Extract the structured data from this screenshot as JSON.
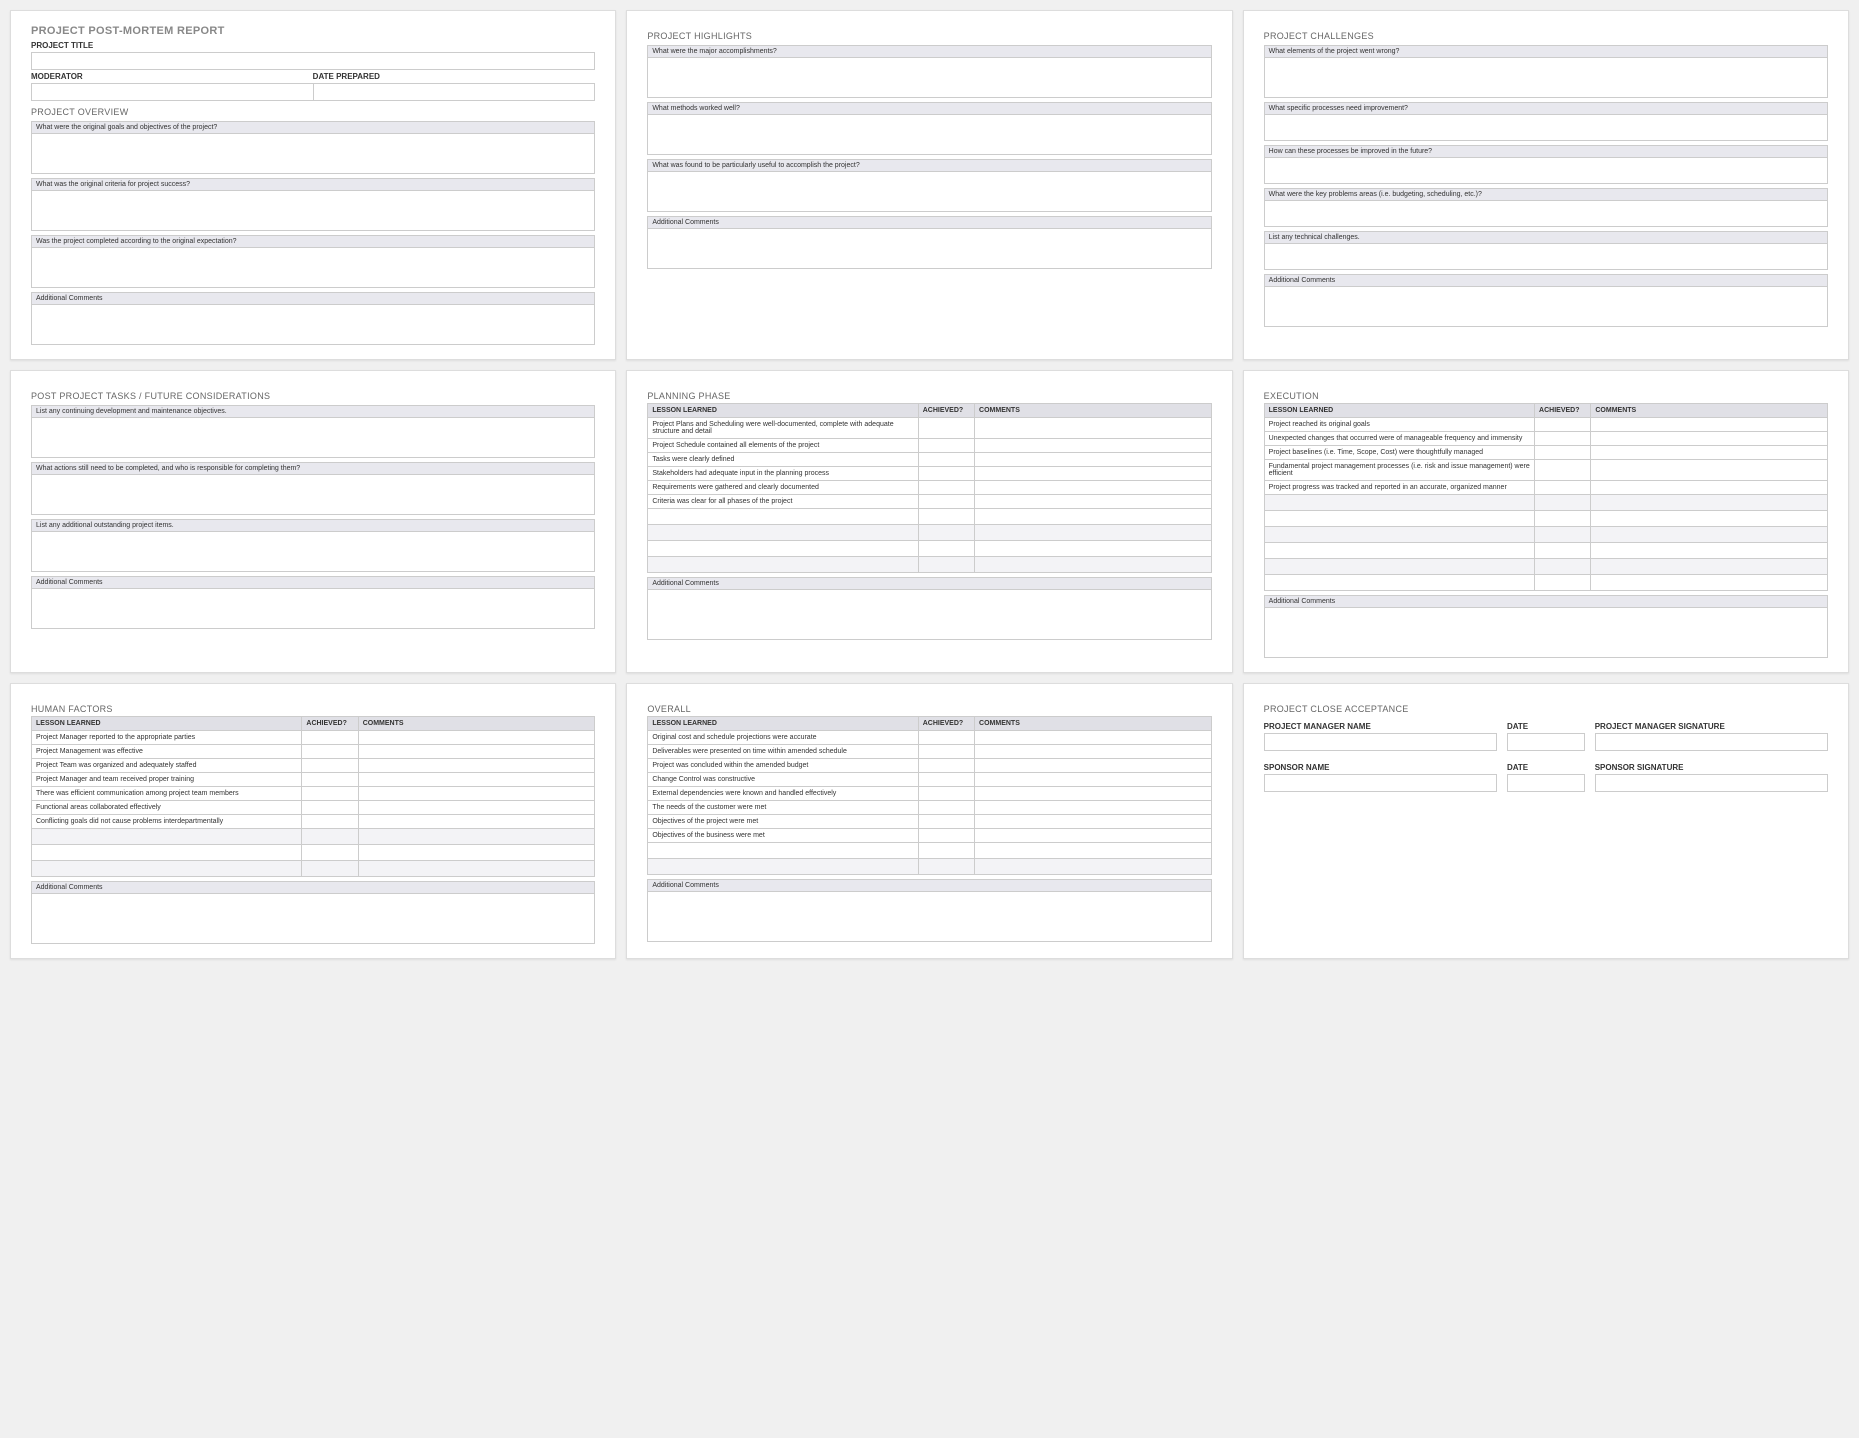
{
  "card1": {
    "title": "PROJECT POST-MORTEM REPORT",
    "project_title_label": "PROJECT TITLE",
    "moderator_label": "MODERATOR",
    "date_prepared_label": "DATE PREPARED",
    "overview_title": "PROJECT OVERVIEW",
    "q1": "What were the original goals and objectives of the project?",
    "q2": "What was the original criteria for project success?",
    "q3": "Was the project completed according to the original expectation?",
    "addl": "Additional Comments"
  },
  "card2": {
    "title": "PROJECT HIGHLIGHTS",
    "q1": "What were the major accomplishments?",
    "q2": "What methods worked well?",
    "q3": "What was found to be particularly useful to accomplish the project?",
    "addl": "Additional Comments"
  },
  "card3": {
    "title": "PROJECT CHALLENGES",
    "q1": "What elements of the project went wrong?",
    "q2": "What specific processes need improvement?",
    "q3": "How can these processes be improved in the future?",
    "q4": "What were the key problems areas (i.e. budgeting, scheduling, etc.)?",
    "q5": "List any technical challenges.",
    "addl": "Additional Comments"
  },
  "card4": {
    "title": "POST PROJECT TASKS / FUTURE CONSIDERATIONS",
    "q1": "List any continuing development and maintenance objectives.",
    "q2": "What actions still need to be completed, and who is responsible for completing them?",
    "q3": "List any additional outstanding project items.",
    "addl": "Additional Comments"
  },
  "planning": {
    "title": "PLANNING PHASE",
    "cols": {
      "lesson": "LESSON LEARNED",
      "ach": "ACHIEVED?",
      "comm": "COMMENTS"
    },
    "rows": [
      "Project Plans and Scheduling were well-documented, complete with adequate structure and detail",
      "Project Schedule contained all elements of the project",
      "Tasks were clearly defined",
      "Stakeholders had adequate input in the planning process",
      "Requirements were gathered and clearly documented",
      "Criteria was clear for all phases of the project",
      "",
      "",
      "",
      ""
    ],
    "addl": "Additional Comments"
  },
  "execution": {
    "title": "EXECUTION",
    "cols": {
      "lesson": "LESSON LEARNED",
      "ach": "ACHIEVED?",
      "comm": "COMMENTS"
    },
    "rows": [
      "Project reached its original goals",
      "Unexpected changes that occurred were of manageable frequency and immensity",
      "Project baselines (i.e. Time, Scope, Cost) were thoughtfully managed",
      "Fundamental project management processes (i.e. risk and issue management) were efficient",
      "Project progress was tracked and reported in an accurate, organized manner",
      "",
      "",
      "",
      "",
      "",
      ""
    ],
    "addl": "Additional Comments"
  },
  "human": {
    "title": "HUMAN FACTORS",
    "cols": {
      "lesson": "LESSON LEARNED",
      "ach": "ACHIEVED?",
      "comm": "COMMENTS"
    },
    "rows": [
      "Project Manager reported to the appropriate parties",
      "Project Management was effective",
      "Project Team was organized and adequately staffed",
      "Project Manager and team received proper training",
      "There was efficient communication among project team members",
      "Functional areas collaborated effectively",
      "Conflicting goals did not cause problems interdepartmentally",
      "",
      "",
      ""
    ],
    "addl": "Additional Comments"
  },
  "overall": {
    "title": "OVERALL",
    "cols": {
      "lesson": "LESSON LEARNED",
      "ach": "ACHIEVED?",
      "comm": "COMMENTS"
    },
    "rows": [
      "Original cost and schedule projections were accurate",
      "Deliverables were presented on time within amended schedule",
      "Project was concluded within the amended budget",
      "Change Control was constructive",
      "External dependencies were known and handled effectively",
      "The needs of the customer were met",
      "Objectives of the project were met",
      "Objectives of the business were met",
      "",
      ""
    ],
    "addl": "Additional Comments"
  },
  "accept": {
    "title": "PROJECT CLOSE ACCEPTANCE",
    "pm_name": "PROJECT MANAGER NAME",
    "pm_date": "DATE",
    "pm_sig": "PROJECT MANAGER SIGNATURE",
    "sp_name": "SPONSOR NAME",
    "sp_date": "DATE",
    "sp_sig": "SPONSOR SIGNATURE"
  }
}
